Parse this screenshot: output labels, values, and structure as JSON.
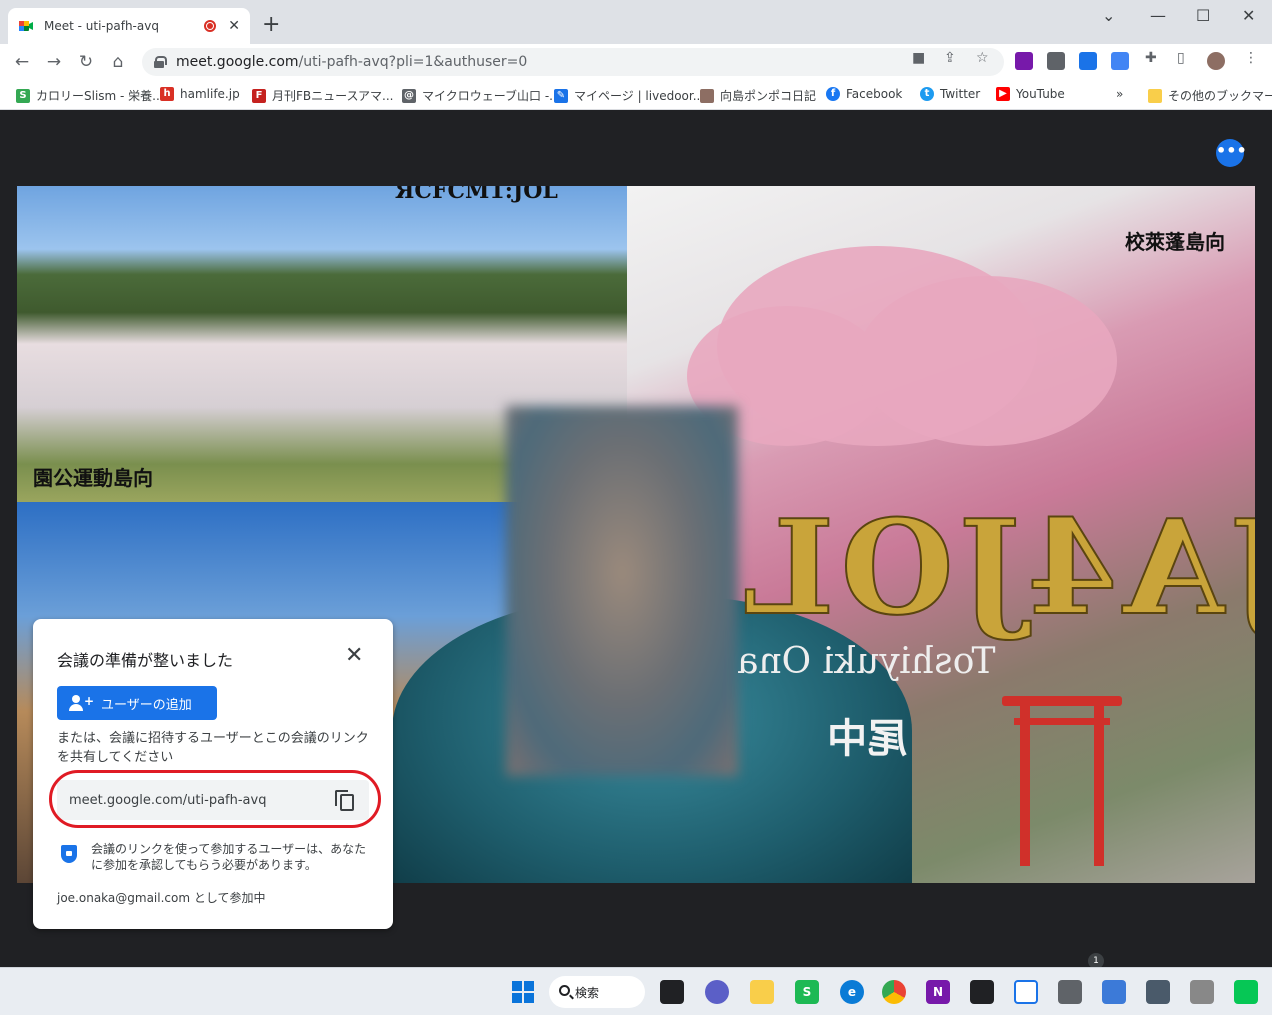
{
  "browser": {
    "tab": {
      "title": "Meet - uti-pafh-avq"
    },
    "url": {
      "host": "meet.google.com",
      "path": "/uti-pafh-avq?pli=1&authuser=0"
    },
    "bookmarks": [
      {
        "label": "カロリーSlism - 栄養...",
        "icon": "slism-icon",
        "color": "#34a853"
      },
      {
        "label": "hamlife.jp",
        "icon": "hamlife-icon",
        "color": "#d93025"
      },
      {
        "label": "月刊FBニュース",
        "icon": "fb-news-icon",
        "color": "#c5221f"
      },
      {
        "label": "アマ...",
        "icon": "",
        "color": ""
      },
      {
        "label": "マイクロウェーブ山口 -...",
        "icon": "microwave-icon",
        "color": "#5f6368"
      },
      {
        "label": "マイページ | livedoor...",
        "icon": "livedoor-icon",
        "color": "#1a73e8"
      },
      {
        "label": "向島ポンポコ日記",
        "icon": "blog-avatar-icon",
        "color": "#8d6e63"
      },
      {
        "label": "Facebook",
        "icon": "facebook-icon",
        "color": "#1877f2"
      },
      {
        "label": "Twitter",
        "icon": "twitter-icon",
        "color": "#1d9bf0"
      },
      {
        "label": "YouTube",
        "icon": "youtube-icon",
        "color": "#ff0000"
      }
    ],
    "bookmarks_more": "»",
    "other_bookmarks": "その他のブックマーク"
  },
  "meet": {
    "video_overlays": {
      "top_left_text": "園公運動島向",
      "top_center_text": "ЯCFCM1:JOL",
      "top_right_text": "校萊蓬島向",
      "ja_text": "JA4JOL",
      "name_text": "Toshiyuki Ona",
      "kanji_text": "尾中"
    },
    "dialog": {
      "title": "会議の準備が整いました",
      "add_button": "ユーザーの追加",
      "description": "または、会議に招待するユーザーとこの会議のリンクを共有してください",
      "link": "meet.google.com/uti-pafh-avq",
      "note": "会議のリンクを使って参加するユーザーは、あなたに参加を承認してもらう必要があります。",
      "account": "joe.onaka@gmail.com として参加中"
    }
  },
  "taskbar": {
    "search_label": "検索",
    "notification_count": "1"
  },
  "colors": {
    "accent": "#1a73e8",
    "highlight_circle": "#e01b24"
  }
}
